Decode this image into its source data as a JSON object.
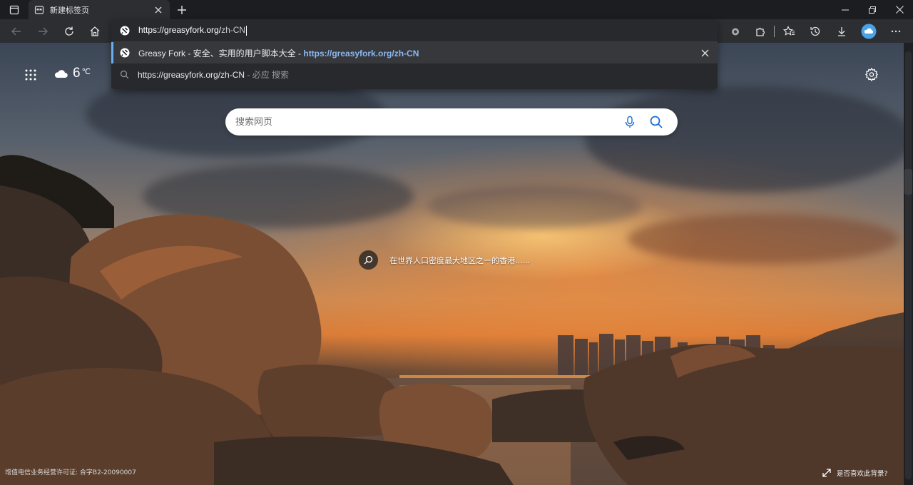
{
  "tab": {
    "title": "新建标签页"
  },
  "omnibox": {
    "typed_host": "https://greasyfork.org/",
    "typed_path": "zh-CN",
    "suggestions": [
      {
        "title": "Greasy Fork - 安全、实用的用户脚本大全",
        "separator": " - ",
        "url": "https://greasyfork.org/zh-CN",
        "icon": "greasyfork-icon"
      },
      {
        "title": "https://greasyfork.org/zh-CN",
        "suffix": " - 必应 搜索",
        "icon": "search-icon"
      }
    ]
  },
  "weather": {
    "temp": "6",
    "unit": "℃",
    "icon": "cloud-icon"
  },
  "search": {
    "placeholder": "搜索网页"
  },
  "caption": {
    "text": "在世界人口密度最大地区之一的香港......"
  },
  "footer": {
    "license": "增值电信业务经营许可证: 合字B2-20090007",
    "like_prompt": "是否喜欢此背景?"
  },
  "colors": {
    "accent": "#6aaef2",
    "toolbar": "#2d2e32",
    "titlebar": "#1c1d21",
    "profile": "#4aa3e8"
  }
}
